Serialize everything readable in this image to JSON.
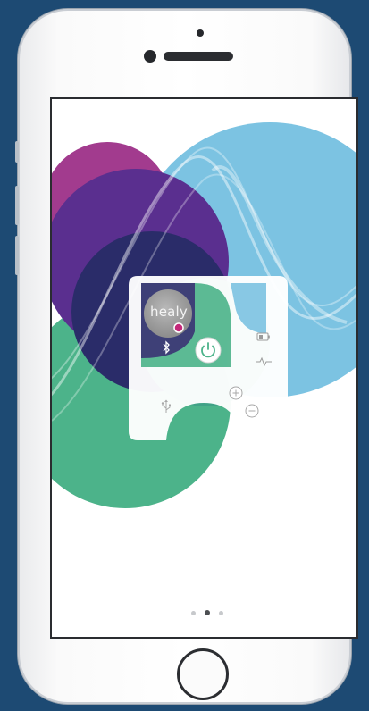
{
  "device": {
    "logo_text": "healy"
  },
  "pager": {
    "total_pages": 3,
    "active_page": 2
  },
  "icons": [
    "bluetooth-icon",
    "power-icon",
    "battery-icon",
    "pulse-icon",
    "usb-icon",
    "plus-icon",
    "minus-icon"
  ],
  "colors": {
    "background": "#1d4a73",
    "circle_light_blue": "#7cc3e2",
    "circle_purple": "#5a2f8f",
    "circle_navy": "#2a2c69",
    "circle_green": "#4cb38a",
    "circle_magenta": "#a23b8e",
    "logo_dot": "#c4287a"
  }
}
